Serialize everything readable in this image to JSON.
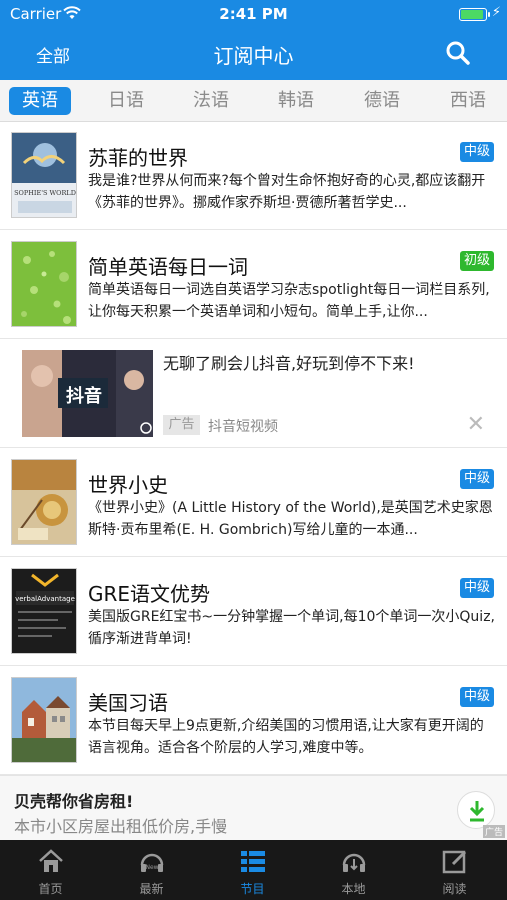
{
  "status": {
    "carrier": "Carrier",
    "time": "2:41 PM"
  },
  "nav": {
    "left": "全部",
    "title": "订阅中心"
  },
  "tabs": [
    "英语",
    "日语",
    "法语",
    "韩语",
    "德语",
    "西语"
  ],
  "active_tab": "英语",
  "items": [
    {
      "title": "苏菲的世界",
      "desc": "我是谁?世界从何而来?每个曾对生命怀抱好奇的心灵,都应该翻开《苏菲的世界》。挪威作家乔斯坦·贾德所著哲学史...",
      "badge": "中级"
    },
    {
      "title": "简单英语每日一词",
      "desc": "简单英语每日一词选自英语学习杂志spotlight每日一词栏目系列,让你每天积累一个英语单词和小短句。简单上手,让你...",
      "badge": "初级"
    },
    {
      "title": "世界小史",
      "desc": "《世界小史》(A Little History of the World),是英国艺术史家恩斯特·贡布里希(E. H. Gombrich)写给儿童的一本通...",
      "badge": "中级"
    },
    {
      "title": "GRE语文优势",
      "desc": "美国版GRE红宝书~一分钟掌握一个单词,每10个单词一次小Quiz,循序渐进背单词!",
      "badge": "中级"
    },
    {
      "title": "美国习语",
      "desc": "本节目每天早上9点更新,介绍美国的习惯用语,让大家有更开阔的语言视角。适合各个阶层的人学习,难度中等。",
      "badge": "中级"
    }
  ],
  "ad": {
    "text": "无聊了刷会儿抖音,好玩到停不下来!",
    "tag": "广告",
    "source": "抖音短视频",
    "thumb_label": "抖音"
  },
  "bottom_ad": {
    "title": "贝壳帮你省房租!",
    "subtitle": "本市小区房屋出租低价房,手慢",
    "label": "广告"
  },
  "bottom_tabs": [
    "首页",
    "最新",
    "节目",
    "本地",
    "阅读"
  ],
  "thumb_texts": {
    "sophie": "SOPHIE'S WORLD",
    "gre": "verbalAdvantage"
  }
}
